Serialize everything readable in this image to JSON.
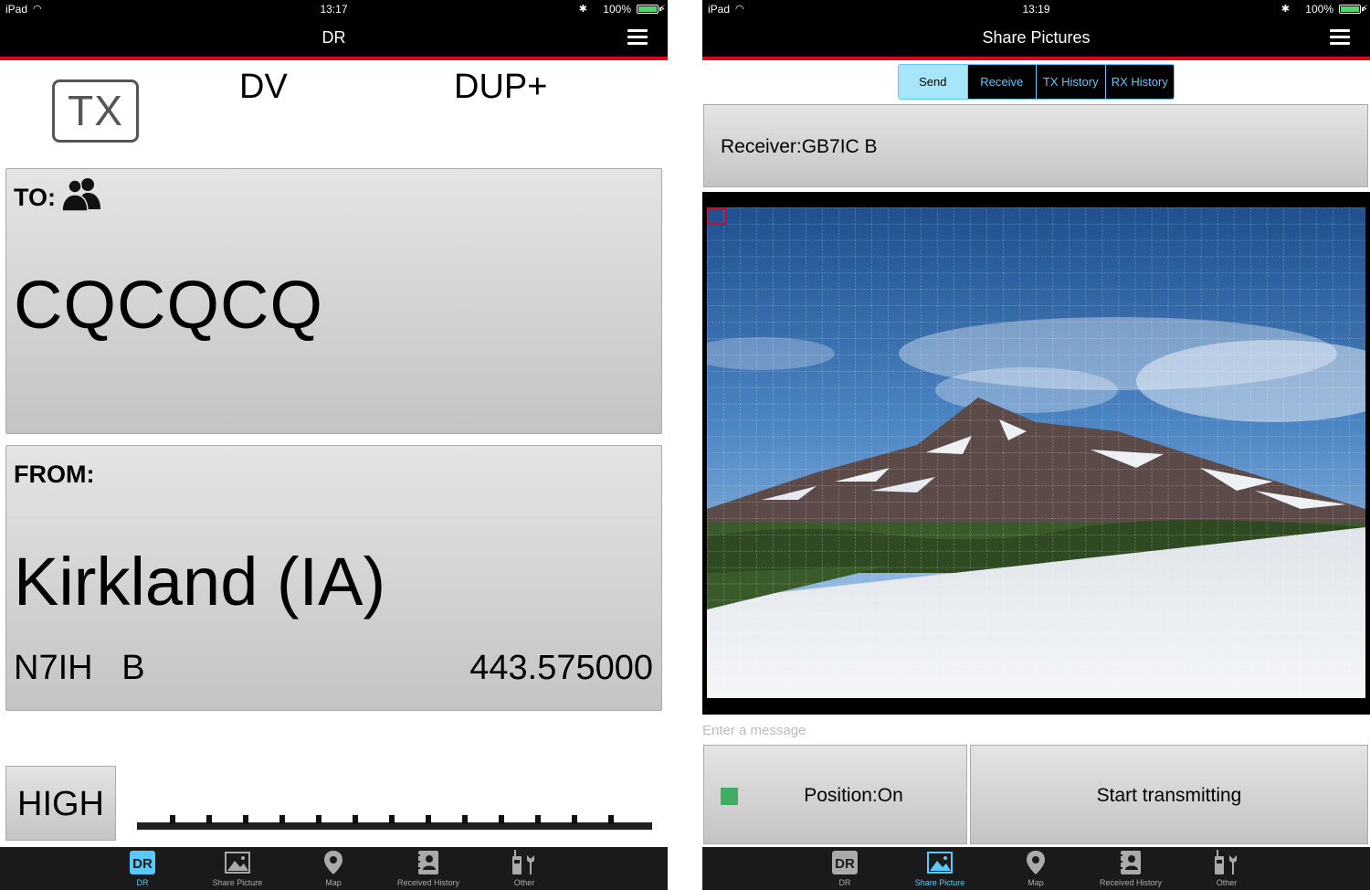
{
  "left": {
    "status": {
      "carrier": "iPad",
      "time": "13:17",
      "battery": "100%"
    },
    "nav": {
      "title": "DR"
    },
    "tx_label": "TX",
    "mode": "DV",
    "duplex": "DUP+",
    "to": {
      "label": "TO:",
      "call": "CQCQCQ"
    },
    "from": {
      "label": "FROM:",
      "name": "Kirkland (IA)",
      "call": "N7IH   B",
      "freq": "443.575000"
    },
    "power_label": "HIGH",
    "tabs": [
      {
        "label": "DR",
        "icon": "dr-icon"
      },
      {
        "label": "Share Picture",
        "icon": "picture-icon"
      },
      {
        "label": "Map",
        "icon": "map-pin-icon"
      },
      {
        "label": "Received History",
        "icon": "contact-book-icon"
      },
      {
        "label": "Other",
        "icon": "radio-tools-icon"
      }
    ],
    "active_tab": "DR"
  },
  "right": {
    "status": {
      "carrier": "iPad",
      "time": "13:19",
      "battery": "100%"
    },
    "nav": {
      "title": "Share Pictures"
    },
    "segments": [
      "Send",
      "Receive",
      "TX History",
      "RX History"
    ],
    "active_segment": "Send",
    "receiver_label": "Receiver:GB7IC B",
    "message_placeholder": "Enter a message",
    "position_label": "Position:On",
    "start_label": "Start transmitting",
    "tabs": [
      {
        "label": "DR",
        "icon": "dr-icon"
      },
      {
        "label": "Share Picture",
        "icon": "picture-icon"
      },
      {
        "label": "Map",
        "icon": "map-pin-icon"
      },
      {
        "label": "Received History",
        "icon": "contact-book-icon"
      },
      {
        "label": "Other",
        "icon": "radio-tools-icon"
      }
    ],
    "active_tab": "Share Picture"
  },
  "colors": {
    "accent": "#5ac8fa",
    "nav_red": "#e2001a",
    "position_led": "#3fae62"
  }
}
